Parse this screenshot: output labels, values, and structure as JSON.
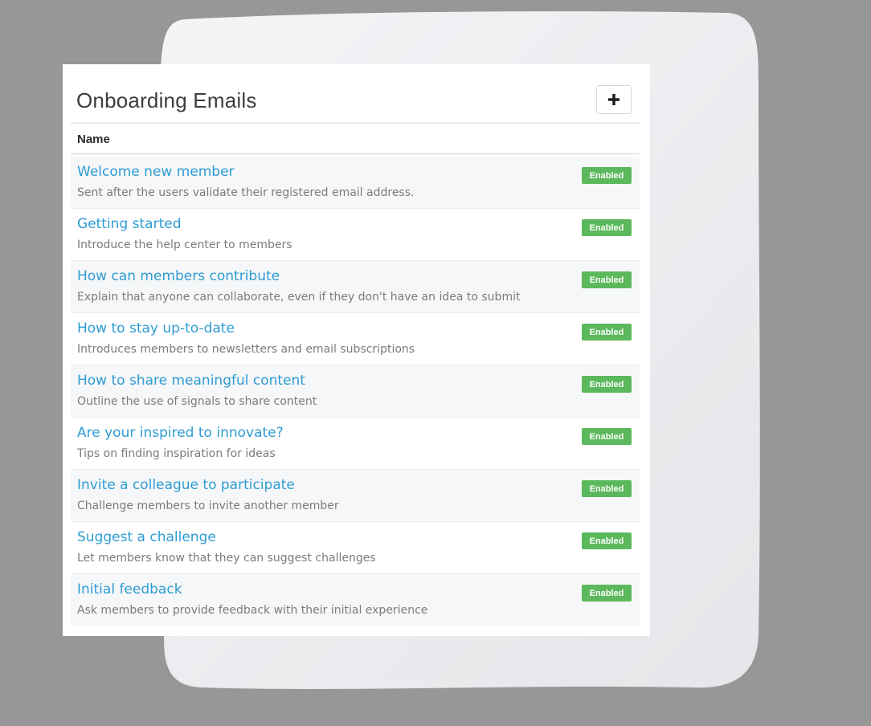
{
  "panel": {
    "title": "Onboarding Emails",
    "add_button_icon": "plus-icon"
  },
  "table": {
    "columns": [
      "Name"
    ],
    "rows": [
      {
        "title": "Welcome new member",
        "description": "Sent after the users validate their registered email address.",
        "status": "Enabled"
      },
      {
        "title": "Getting started",
        "description": "Introduce the help center to members",
        "status": "Enabled"
      },
      {
        "title": "How can members contribute",
        "description": "Explain that anyone can collaborate, even if they don't have an idea to submit",
        "status": "Enabled"
      },
      {
        "title": "How to stay up-to-date",
        "description": "Introduces members to newsletters and email subscriptions",
        "status": "Enabled"
      },
      {
        "title": "How to share meaningful content",
        "description": "Outline the use of signals to share content",
        "status": "Enabled"
      },
      {
        "title": "Are your inspired to innovate?",
        "description": "Tips on finding inspiration for ideas",
        "status": "Enabled"
      },
      {
        "title": "Invite a colleague to participate",
        "description": "Challenge members to invite another member",
        "status": "Enabled"
      },
      {
        "title": "Suggest a challenge",
        "description": "Let members know that they can suggest challenges",
        "status": "Enabled"
      },
      {
        "title": "Initial feedback",
        "description": "Ask members to provide feedback with their initial experience",
        "status": "Enabled"
      }
    ]
  },
  "colors": {
    "background": "#979797",
    "link": "#2e9cd4",
    "badge": "#5cb85c"
  }
}
